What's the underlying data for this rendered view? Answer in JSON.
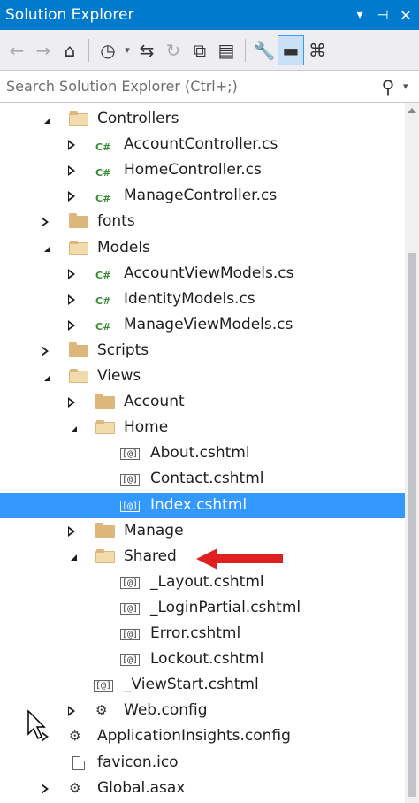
{
  "window": {
    "title": "Solution Explorer",
    "menu_glyph": "▾",
    "pin_glyph": "⊣",
    "close_glyph": "✕"
  },
  "toolbar": {
    "back_icon": "←",
    "forward_icon": "→",
    "home_icon": "⌂",
    "history_icon": "◷",
    "history_drop": "▾",
    "sync_icon": "⇆",
    "refresh_icon": "↻",
    "collapse_all_icon": "⧉",
    "show_all_files_icon": "▤",
    "properties_icon": "🔧",
    "preview_icon": "▬",
    "view_class_diagram_icon": "⌘"
  },
  "search": {
    "placeholder": "Search Solution Explorer (Ctrl+;)",
    "value": "",
    "search_icon": "⚲",
    "dropdown_glyph": "▾"
  },
  "tree": [
    {
      "label": "Controllers",
      "icon": "folder-open",
      "state": "expanded",
      "level": 1
    },
    {
      "label": "AccountController.cs",
      "icon": "csharp-file",
      "state": "collapsed",
      "level": 2
    },
    {
      "label": "HomeController.cs",
      "icon": "csharp-file",
      "state": "collapsed",
      "level": 2
    },
    {
      "label": "ManageController.cs",
      "icon": "csharp-file",
      "state": "collapsed",
      "level": 2
    },
    {
      "label": "fonts",
      "icon": "folder",
      "state": "collapsed",
      "level": 1
    },
    {
      "label": "Models",
      "icon": "folder-open",
      "state": "expanded",
      "level": 1
    },
    {
      "label": "AccountViewModels.cs",
      "icon": "csharp-file",
      "state": "collapsed",
      "level": 2
    },
    {
      "label": "IdentityModels.cs",
      "icon": "csharp-file",
      "state": "collapsed",
      "level": 2
    },
    {
      "label": "ManageViewModels.cs",
      "icon": "csharp-file",
      "state": "collapsed",
      "level": 2
    },
    {
      "label": "Scripts",
      "icon": "folder",
      "state": "collapsed",
      "level": 1
    },
    {
      "label": "Views",
      "icon": "folder-open",
      "state": "expanded",
      "level": 1
    },
    {
      "label": "Account",
      "icon": "folder",
      "state": "collapsed",
      "level": 2
    },
    {
      "label": "Home",
      "icon": "folder-open",
      "state": "expanded",
      "level": 2
    },
    {
      "label": "About.cshtml",
      "icon": "razor-file",
      "state": "none",
      "level": 3
    },
    {
      "label": "Contact.cshtml",
      "icon": "razor-file",
      "state": "none",
      "level": 3
    },
    {
      "label": "Index.cshtml",
      "icon": "razor-file",
      "state": "none",
      "level": 3,
      "selected": true
    },
    {
      "label": "Manage",
      "icon": "folder",
      "state": "collapsed",
      "level": 2
    },
    {
      "label": "Shared",
      "icon": "folder-open",
      "state": "expanded",
      "level": 2
    },
    {
      "label": "_Layout.cshtml",
      "icon": "razor-file",
      "state": "none",
      "level": 3
    },
    {
      "label": "_LoginPartial.cshtml",
      "icon": "razor-file",
      "state": "none",
      "level": 3
    },
    {
      "label": "Error.cshtml",
      "icon": "razor-file",
      "state": "none",
      "level": 3
    },
    {
      "label": "Lockout.cshtml",
      "icon": "razor-file",
      "state": "none",
      "level": 3
    },
    {
      "label": "_ViewStart.cshtml",
      "icon": "razor-file",
      "state": "none",
      "level": 2
    },
    {
      "label": "Web.config",
      "icon": "config-file",
      "state": "collapsed",
      "level": 2
    },
    {
      "label": "ApplicationInsights.config",
      "icon": "config-file",
      "state": "collapsed",
      "level": 1
    },
    {
      "label": "favicon.ico",
      "icon": "ico-file",
      "state": "none",
      "level": 1
    },
    {
      "label": "Global.asax",
      "icon": "config-file",
      "state": "collapsed",
      "level": 1
    }
  ],
  "glyphs": {
    "csharp": "C#",
    "razor": "[@]",
    "config": "⚙"
  },
  "colors": {
    "accent": "#007acc",
    "selection": "#3399ff",
    "annotation_arrow": "#e02020",
    "csharp_icon": "#388a34",
    "folder": "#dcb67a"
  }
}
